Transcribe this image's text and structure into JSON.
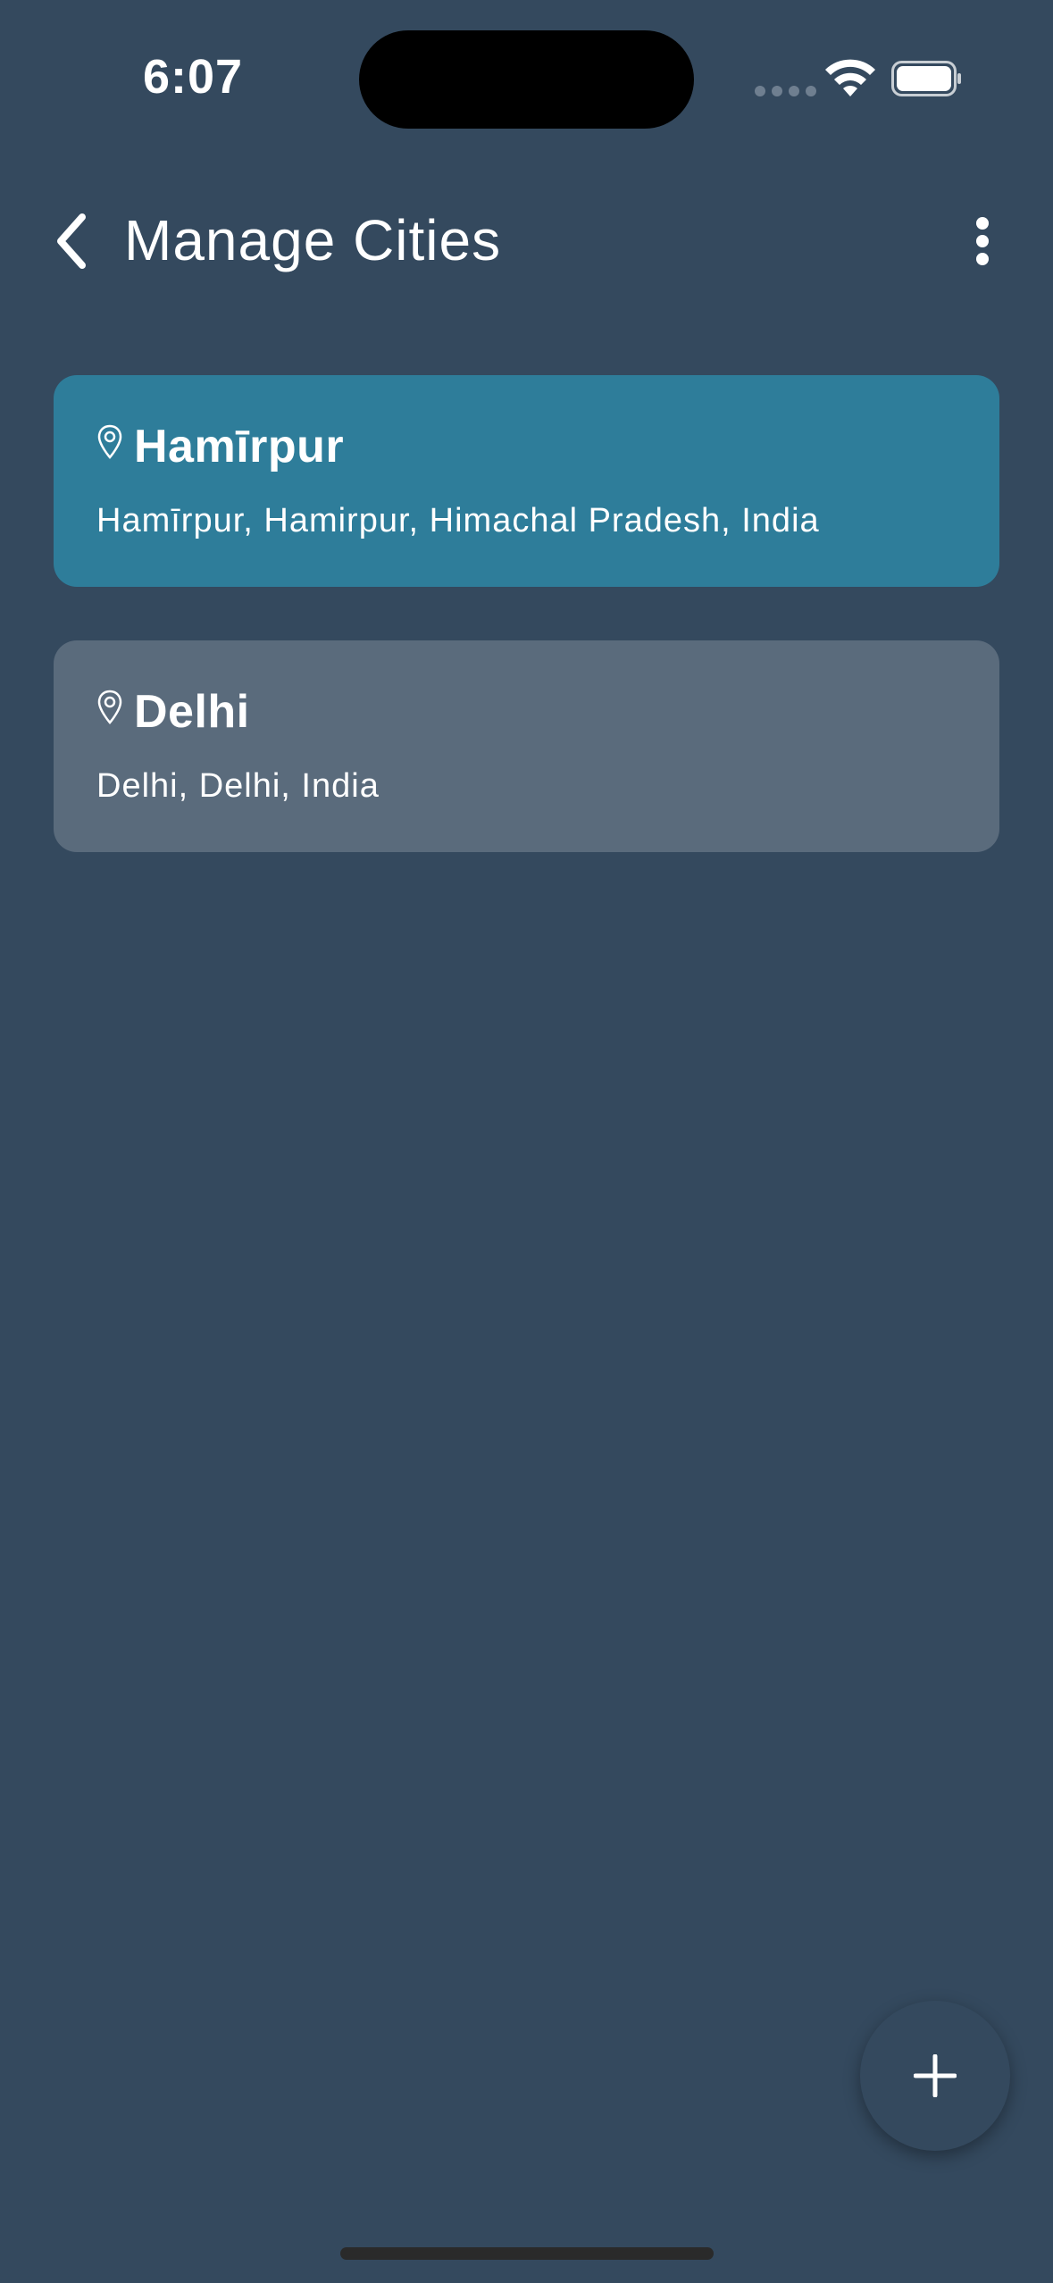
{
  "status_bar": {
    "time": "6:07",
    "icons": [
      "signal-icon",
      "wifi-icon",
      "battery-icon"
    ]
  },
  "header": {
    "title": "Manage Cities",
    "back_icon": "chevron-left-icon",
    "menu_icon": "more-vertical-icon"
  },
  "cities": [
    {
      "name": "Hamīrpur",
      "address": "Hamīrpur,  Hamirpur,  Himachal Pradesh,  India",
      "icon": "location-pin-icon",
      "selected": true
    },
    {
      "name": "Delhi",
      "address": "Delhi,  Delhi,  India",
      "icon": "location-pin-icon",
      "selected": false
    }
  ],
  "fab": {
    "icon": "plus-icon"
  },
  "colors": {
    "background": "#34495e",
    "selected_card": "#2e7d9a",
    "card": "#5a6b7c",
    "text": "#ffffff"
  }
}
